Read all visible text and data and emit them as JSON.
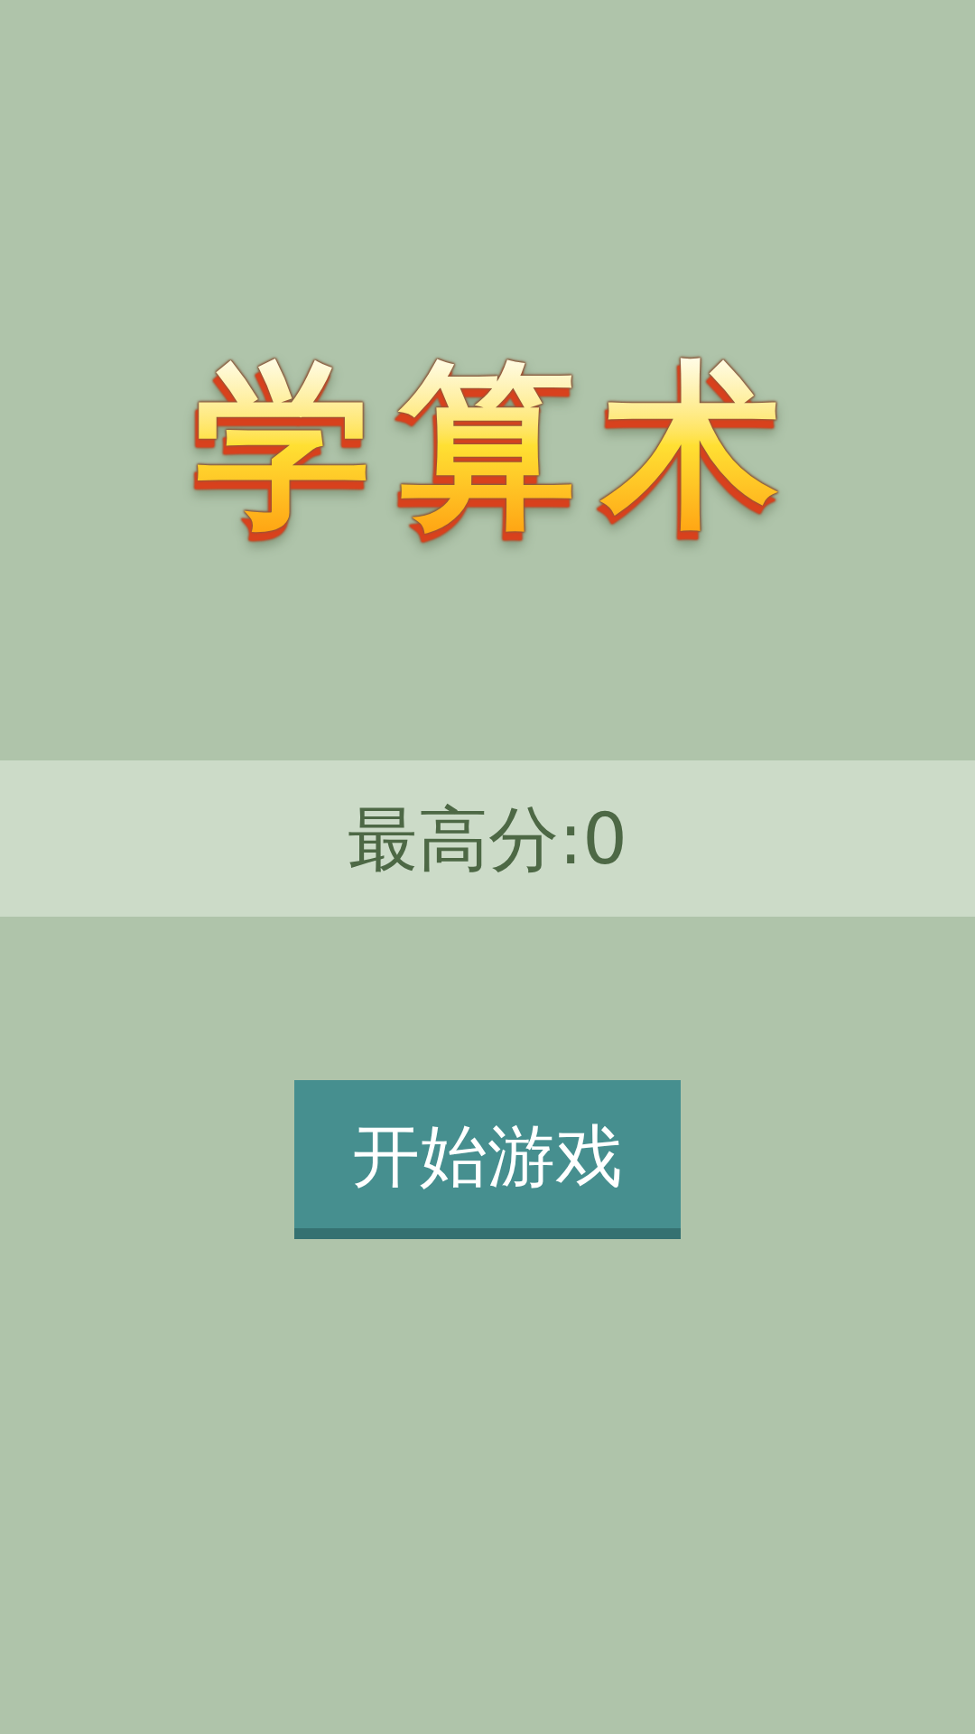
{
  "title": "学算术",
  "score_bar": {
    "text": "最高分:0"
  },
  "start_button": {
    "label": "开始游戏"
  }
}
